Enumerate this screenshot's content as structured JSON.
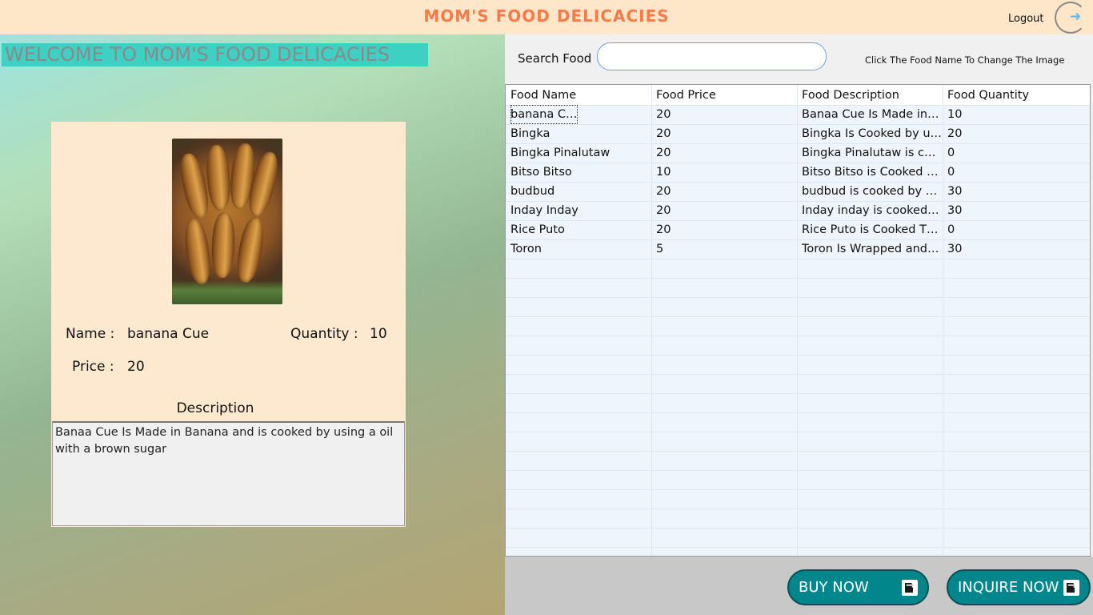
{
  "header": {
    "title": "MOM'S FOOD DELICACIES",
    "logout_label": "Logout",
    "logout_icon": "logout-arrow-icon"
  },
  "left": {
    "welcome": "WELCOME TO MOM'S FOOD DELICACIES",
    "detail": {
      "name_label": "Name :",
      "name_value": "banana Cue",
      "quantity_label": "Quantity :",
      "quantity_value": "10",
      "price_label": "Price :",
      "price_value": "20",
      "description_title": "Description",
      "description_text": "Banaa Cue Is Made in Banana and is cooked by using a oil with a brown sugar"
    }
  },
  "right": {
    "search_label": "Search Food",
    "search_value": "",
    "hint": "Click The Food Name To Change The Image",
    "table": {
      "columns": [
        "Food Name",
        "Food Price",
        "Food Description",
        "Food Quantity"
      ],
      "rows": [
        [
          "banana Cue",
          "20",
          "Banaa Cue Is Made in B...",
          "10"
        ],
        [
          "Bingka",
          "20",
          "Bingka Is Cooked by usi...",
          "20"
        ],
        [
          "Bingka Pinalutaw",
          "20",
          "Bingka Pinalutaw is coo...",
          "0"
        ],
        [
          "Bitso Bitso",
          "10",
          "Bitso Bitso is Cooked By...",
          "0"
        ],
        [
          "budbud",
          "20",
          "budbud is cooked by usi...",
          "30"
        ],
        [
          "Inday Inday",
          "20",
          "Inday inday is cooked b...",
          "30"
        ],
        [
          "Rice Puto",
          "20",
          "Rice Puto is Cooked Thr...",
          "0"
        ],
        [
          "Toron",
          "5",
          "Toron Is Wrapped and is...",
          "30"
        ]
      ]
    },
    "buttons": {
      "buy": "BUY NOW",
      "inquire": "INQUIRE NOW"
    }
  },
  "colors": {
    "title": "#f57b4a",
    "welcome_bg": "#3fd0c4",
    "button_bg": "#00868b"
  }
}
